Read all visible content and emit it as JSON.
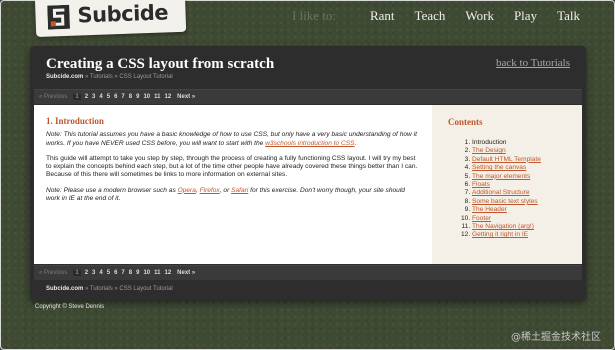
{
  "site": {
    "name": "Subcide"
  },
  "nav": {
    "like_text": "I like to:",
    "items": [
      "Rant",
      "Teach",
      "Work",
      "Play",
      "Talk"
    ]
  },
  "header": {
    "title": "Creating a CSS layout from scratch",
    "breadcrumb": [
      "Subcide.com",
      "Tutorials",
      "CSS Layout Tutorial"
    ],
    "back_link": "back to Tutorials"
  },
  "pagination": {
    "prev": "« Previous",
    "pages": [
      "1",
      "2",
      "3",
      "4",
      "5",
      "6",
      "7",
      "8",
      "9",
      "10",
      "11",
      "12"
    ],
    "current": "1",
    "next": "Next »"
  },
  "article": {
    "heading": "1. Introduction",
    "note1": "Note: This tutorial assumes you have a basic knowledge of how to use CSS, but only have a very basic understanding of how it works. If you have NEVER used CSS before, you will want to start with the ",
    "note1_link": "w3schools introduction to CSS",
    "note1_end": ".",
    "para": "This guide will attempt to take you step by step, through the process of creating a fully functioning CSS layout. I will try my best to explain the concepts behind each step, but a lot of the time other people have already covered these things better than I can. Because of this there will sometimes be links to more information on external sites.",
    "note2_start": "Note: Please use a modern browser such as ",
    "browser1": "Opera",
    "sep1": ", ",
    "browser2": "Firefox",
    "sep2": ", or ",
    "browser3": "Safari",
    "note2_end": " for this exercise. Don't worry though, your site should work in IE at the end of it."
  },
  "contents": {
    "heading": "Contents",
    "items": [
      "Introduction",
      "The Design",
      "Default HTML Template",
      "Setting the canvas",
      "The major elements",
      "Floats",
      "Additional Structure",
      "Some basic text styles",
      "The Header",
      "Footer",
      "The Navigation (arg!)",
      "Getting it right in IE"
    ]
  },
  "footer": {
    "copyright": "Copyright © Steve Dennis"
  },
  "watermark": "@稀土掘金技术社区",
  "colors": {
    "accent": "#c0562b",
    "panel": "#2d2d2d",
    "background": "#3f4a33"
  }
}
